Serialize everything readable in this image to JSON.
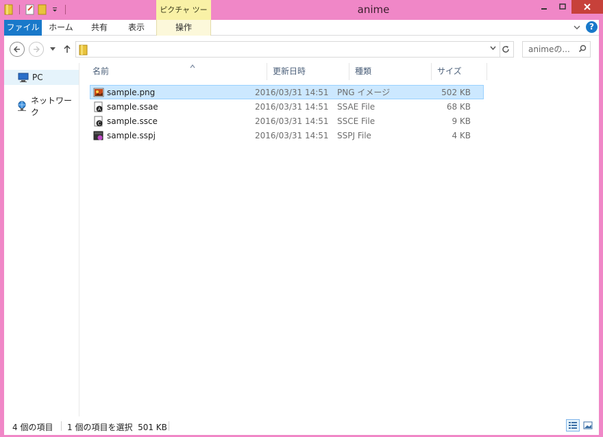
{
  "window": {
    "title": "anime"
  },
  "ribbon": {
    "contextual_group": "ピクチャ ツール",
    "tabs": [
      {
        "label": "ファイル"
      },
      {
        "label": "ホーム"
      },
      {
        "label": "共有"
      },
      {
        "label": "表示"
      },
      {
        "label": "操作"
      }
    ],
    "help_label": "?"
  },
  "navbar": {
    "address_path": "",
    "search_placeholder": "animeの..."
  },
  "navpane": {
    "items": [
      {
        "label": "PC",
        "icon": "pc-icon"
      },
      {
        "label": "ネットワーク",
        "icon": "network-icon"
      }
    ]
  },
  "columns": {
    "name": "名前",
    "date": "更新日時",
    "type": "種類",
    "size": "サイズ"
  },
  "files": [
    {
      "name": "sample.png",
      "date": "2016/03/31 14:51",
      "type": "PNG イメージ",
      "size": "502 KB",
      "selected": true
    },
    {
      "name": "sample.ssae",
      "date": "2016/03/31 14:51",
      "type": "SSAE File",
      "size": "68 KB"
    },
    {
      "name": "sample.ssce",
      "date": "2016/03/31 14:51",
      "type": "SSCE File",
      "size": "9 KB"
    },
    {
      "name": "sample.sspj",
      "date": "2016/03/31 14:51",
      "type": "SSPJ File",
      "size": "4 KB"
    }
  ],
  "status": {
    "item_count": "4 個の項目",
    "selection": "1 個の項目を選択  501 KB"
  },
  "colors": {
    "frame": "#f087c7",
    "accent": "#1979ca",
    "selection": "#cce8ff",
    "context_tab": "#f9f1a6"
  }
}
